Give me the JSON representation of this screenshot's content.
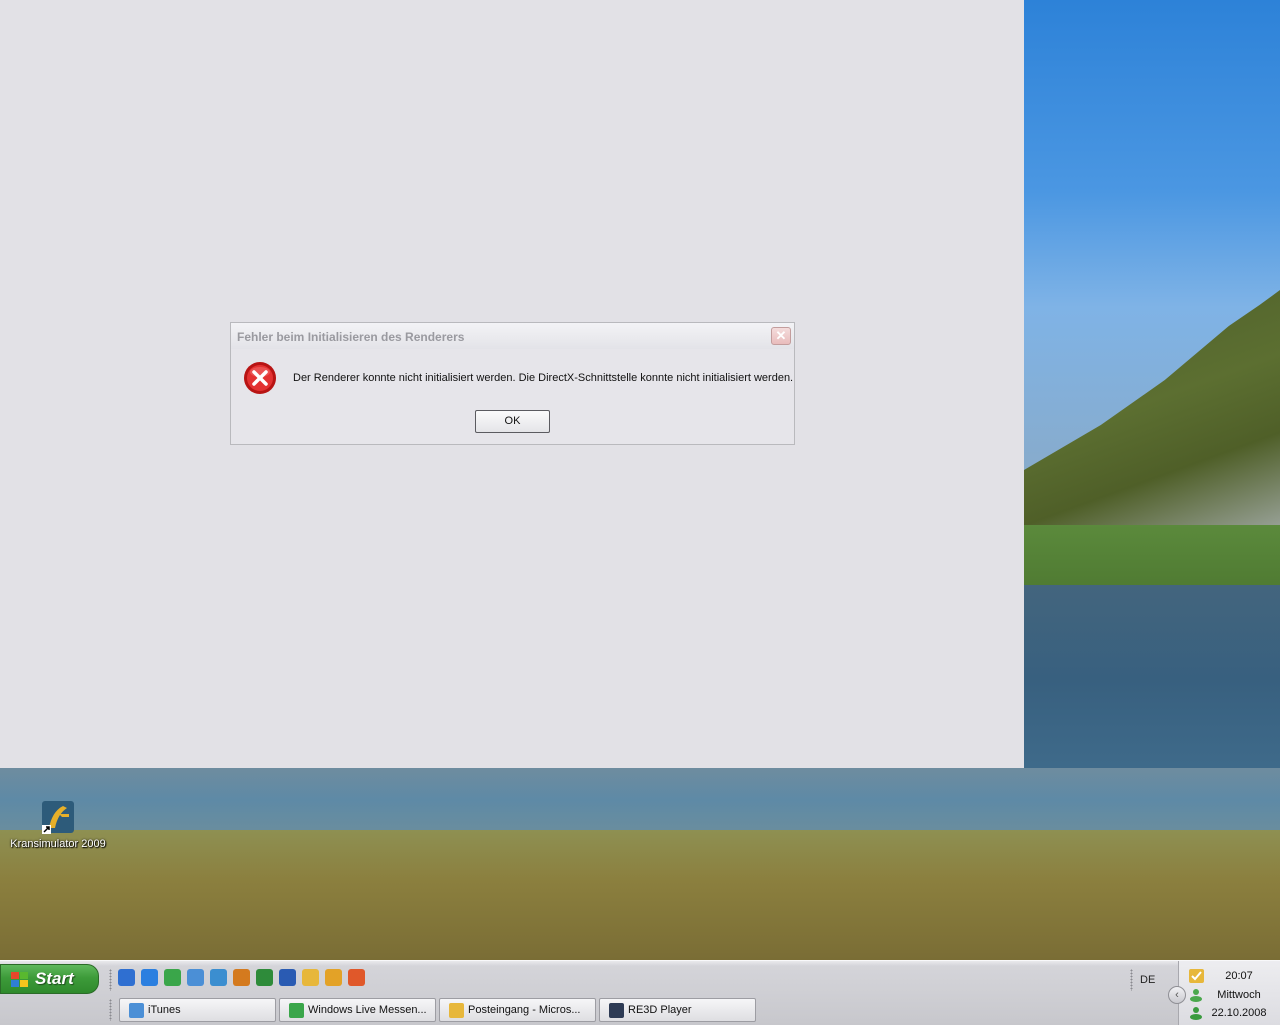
{
  "dialog": {
    "title": "Fehler beim Initialisieren des Renderers",
    "close_label": "✕",
    "message": "Der Renderer konnte nicht initialisiert werden. Die DirectX-Schnittstelle konnte nicht initialisiert werden.",
    "ok_label": "OK"
  },
  "desktop": {
    "icons": [
      {
        "label": "Kransimulator 2009",
        "icon": "kransimulator-icon"
      }
    ]
  },
  "taskbar": {
    "start_label": "Start",
    "quicklaunch": [
      {
        "icon": "show-desktop-icon",
        "color": "#2f6fd1"
      },
      {
        "icon": "internet-explorer-icon",
        "color": "#2b7fe0"
      },
      {
        "icon": "messenger-icon",
        "color": "#3aa64a"
      },
      {
        "icon": "itunes-icon",
        "color": "#4b8fd6"
      },
      {
        "icon": "skype-icon",
        "color": "#3b8ed0"
      },
      {
        "icon": "firefox-icon",
        "color": "#d47a1e"
      },
      {
        "icon": "excel-icon",
        "color": "#2e8b3a"
      },
      {
        "icon": "word-icon",
        "color": "#2a5bb3"
      },
      {
        "icon": "outlook-icon",
        "color": "#e7b73b"
      },
      {
        "icon": "messenger-alt-icon",
        "color": "#e3a227"
      },
      {
        "icon": "media-player-icon",
        "color": "#e0582a"
      }
    ],
    "language": "DE",
    "tasks": [
      {
        "label": "iTunes",
        "icon": "itunes-icon",
        "color": "#4b8fd6"
      },
      {
        "label": "Windows Live Messen...",
        "icon": "messenger-icon",
        "color": "#3aa64a"
      },
      {
        "label": "Posteingang - Micros...",
        "icon": "outlook-icon",
        "color": "#e7b73b"
      },
      {
        "label": "RE3D Player",
        "icon": "re3d-player-icon",
        "color": "#2e3b55"
      }
    ],
    "tray": {
      "time": "20:07",
      "day": "Mittwoch",
      "date": "22.10.2008",
      "expand_label": "‹"
    }
  }
}
